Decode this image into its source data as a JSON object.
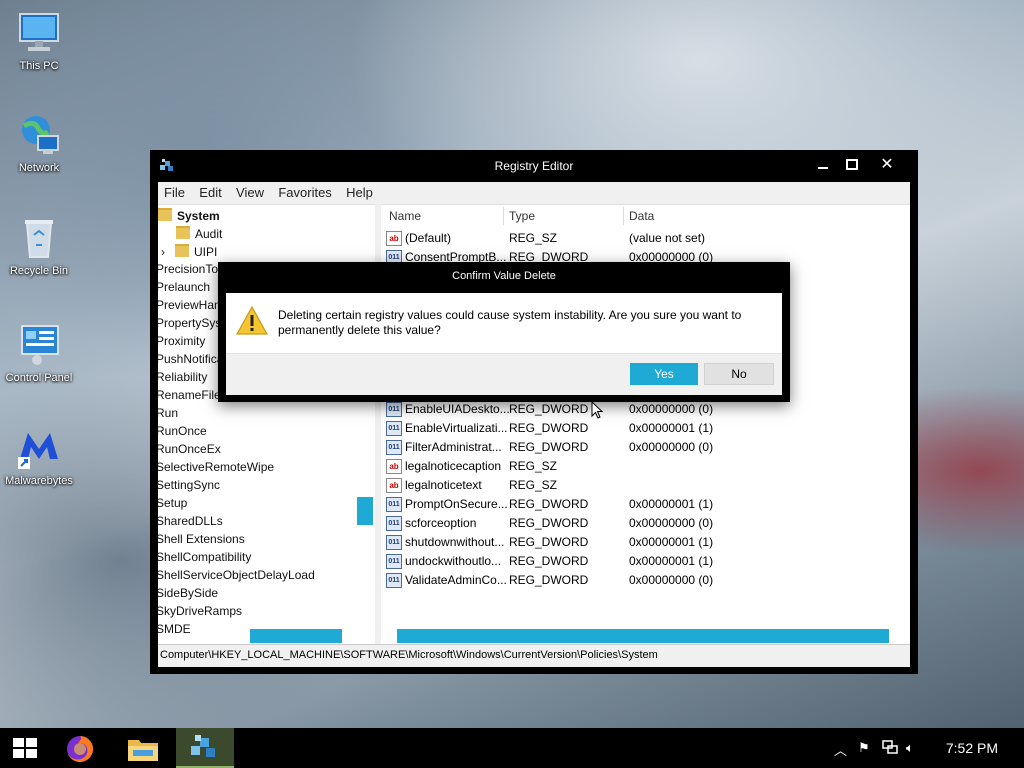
{
  "desktop": {
    "icons": [
      {
        "label": "This PC"
      },
      {
        "label": "Network"
      },
      {
        "label": "Recycle Bin"
      },
      {
        "label": "Control Panel"
      },
      {
        "label": "Malwarebytes"
      }
    ]
  },
  "window": {
    "title": "Registry Editor",
    "controls": {
      "minimize": "—",
      "maximize": "☐",
      "close": "✕"
    },
    "menu": [
      "File",
      "Edit",
      "View",
      "Favorites",
      "Help"
    ],
    "tree": {
      "selected": "System",
      "children": [
        "Audit",
        "UIPI"
      ],
      "items": [
        "PrecisionTou",
        "Prelaunch",
        "PreviewHand",
        "PropertySys",
        "Proximity",
        "PushNotifica",
        "Reliability",
        "RenameFiles",
        "Run",
        "RunOnce",
        "RunOnceEx",
        "SelectiveRemoteWipe",
        "SettingSync",
        "Setup",
        "SharedDLLs",
        "Shell Extensions",
        "ShellCompatibility",
        "ShellServiceObjectDelayLoad",
        "SideBySide",
        "SkyDriveRamps",
        "SMDE"
      ]
    },
    "columns": {
      "name": "Name",
      "type": "Type",
      "data": "Data"
    },
    "values": [
      {
        "icon": "sz",
        "name": "(Default)",
        "type": "REG_SZ",
        "data": "(value not set)"
      },
      {
        "icon": "dw",
        "name": "ConsentPromptB...",
        "type": "REG_DWORD",
        "data": "0x00000000 (0)"
      },
      {
        "icon": "dw",
        "name": "EnableUIADeskto...",
        "type": "REG_DWORD",
        "data": "0x00000000 (0)"
      },
      {
        "icon": "dw",
        "name": "EnableVirtualizati...",
        "type": "REG_DWORD",
        "data": "0x00000001 (1)"
      },
      {
        "icon": "dw",
        "name": "FilterAdministrat...",
        "type": "REG_DWORD",
        "data": "0x00000000 (0)"
      },
      {
        "icon": "sz",
        "name": "legalnoticecaption",
        "type": "REG_SZ",
        "data": ""
      },
      {
        "icon": "sz",
        "name": "legalnoticetext",
        "type": "REG_SZ",
        "data": ""
      },
      {
        "icon": "dw",
        "name": "PromptOnSecure...",
        "type": "REG_DWORD",
        "data": "0x00000001 (1)"
      },
      {
        "icon": "dw",
        "name": "scforceoption",
        "type": "REG_DWORD",
        "data": "0x00000000 (0)"
      },
      {
        "icon": "dw",
        "name": "shutdownwithout...",
        "type": "REG_DWORD",
        "data": "0x00000001 (1)"
      },
      {
        "icon": "dw",
        "name": "undockwithoutlo...",
        "type": "REG_DWORD",
        "data": "0x00000001 (1)"
      },
      {
        "icon": "dw",
        "name": "ValidateAdminCo...",
        "type": "REG_DWORD",
        "data": "0x00000000 (0)"
      }
    ],
    "status_path": "Computer\\HKEY_LOCAL_MACHINE\\SOFTWARE\\Microsoft\\Windows\\CurrentVersion\\Policies\\System"
  },
  "dialog": {
    "title": "Confirm Value Delete",
    "message": "Deleting certain registry values could cause system instability. Are you sure you want to permanently delete this value?",
    "yes": "Yes",
    "no": "No"
  },
  "taskbar": {
    "time": "7:52 PM",
    "apps": [
      "start-icon",
      "firefox-icon",
      "file-explorer-icon",
      "registry-editor-icon"
    ]
  },
  "colors": {
    "accent": "#1eaad4",
    "titlebar": "#000000"
  }
}
